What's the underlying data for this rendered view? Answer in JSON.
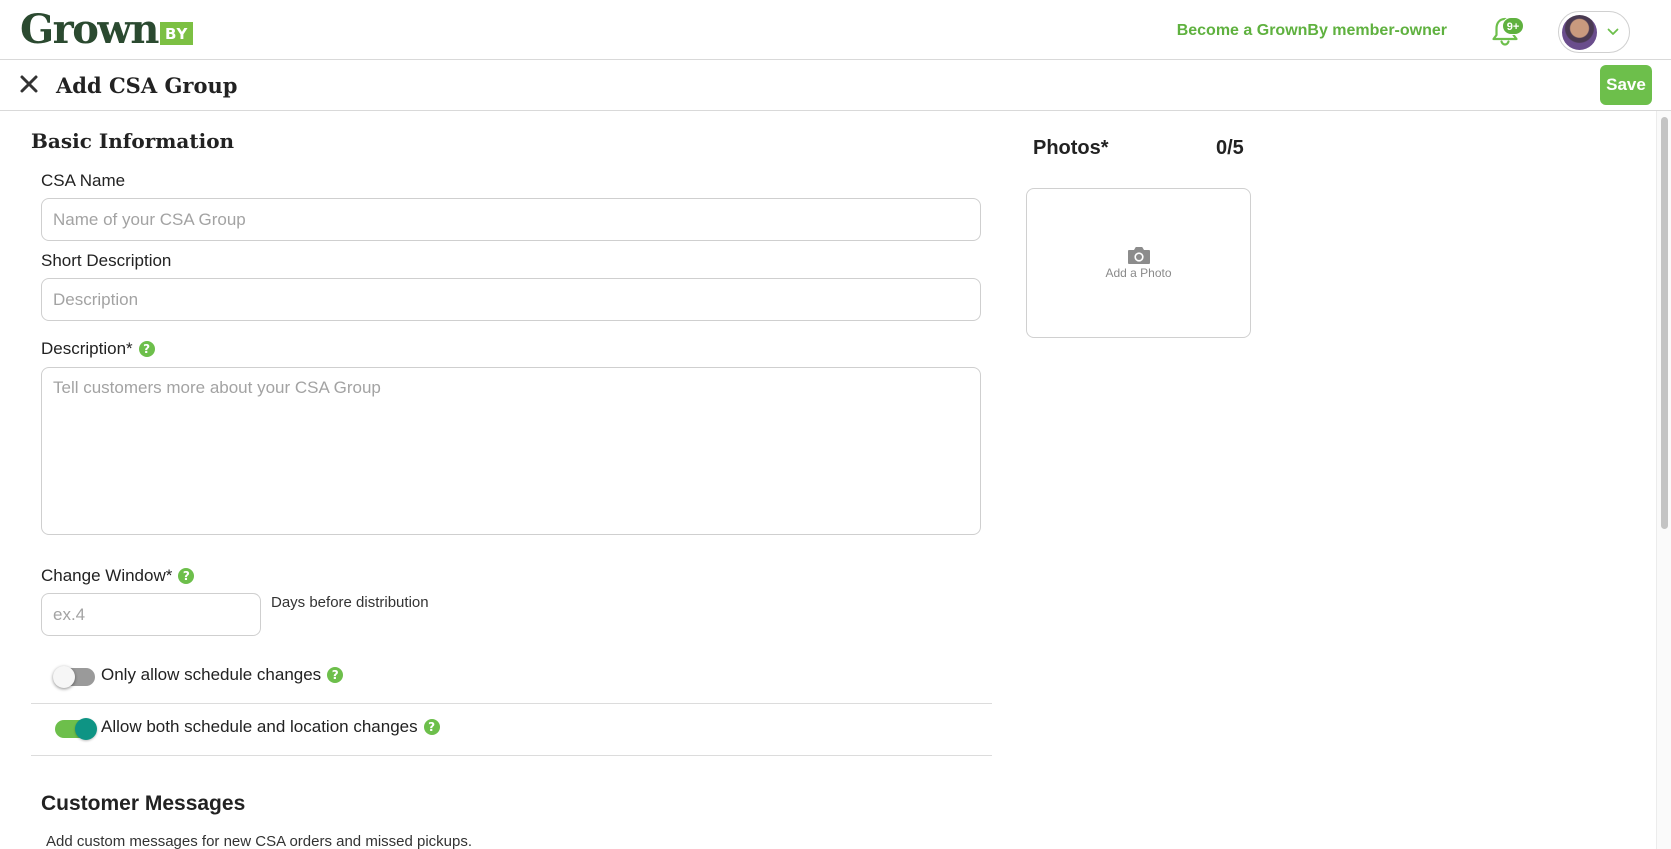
{
  "header": {
    "logo_text": "Grown",
    "logo_suffix": "BY",
    "member_link": "Become a GrownBy member-owner",
    "notification_badge": "9+"
  },
  "subheader": {
    "title": "Add CSA Group",
    "save_label": "Save"
  },
  "basic_info": {
    "section_title": "Basic Information",
    "csa_name_label": "CSA Name",
    "csa_name_placeholder": "Name of your CSA Group",
    "csa_name_value": "",
    "short_desc_label": "Short Description",
    "short_desc_placeholder": "Description",
    "short_desc_value": "",
    "description_label": "Description*",
    "description_placeholder": "Tell customers more about your CSA Group",
    "change_window_label": "Change Window*",
    "change_window_placeholder": "ex.4",
    "change_window_note": "Days before distribution"
  },
  "toggles": [
    {
      "label": "Only allow schedule changes",
      "on": false
    },
    {
      "label": "Allow both schedule and location changes",
      "on": true
    }
  ],
  "customer_messages": {
    "title": "Customer Messages",
    "subtitle": "Add custom messages for new CSA orders and missed pickups."
  },
  "photos": {
    "title": "Photos*",
    "count": "0/5",
    "add_label": "Add a Photo"
  },
  "icons": {
    "close": "close-icon",
    "bell": "bell-icon",
    "chevron": "chevron-down-icon",
    "help": "help-icon",
    "camera": "camera-icon"
  },
  "colors": {
    "brand_green": "#6dbf4b",
    "toggle_knob_on": "#0e9484",
    "logo_dark": "#2b4a30"
  }
}
